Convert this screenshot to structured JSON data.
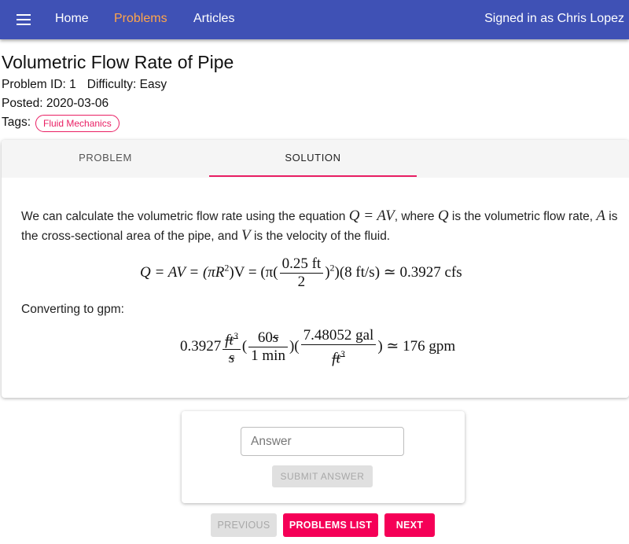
{
  "nav": {
    "items": [
      "Home",
      "Problems",
      "Articles"
    ],
    "active_color": "#ffa54a",
    "bar_color": "#3f51b5",
    "signed_in": "Signed in as Chris Lopez"
  },
  "problem": {
    "title": "Volumetric Flow Rate of Pipe",
    "problem_id": "Problem ID: 1",
    "difficulty": "Difficulty: Easy",
    "posted": "Posted: 2020-03-06",
    "tags_label": "Tags:",
    "tags": [
      "Fluid Mechanics"
    ],
    "tag_color": "#e91e63"
  },
  "tabs": [
    "PROBLEM",
    "SOLUTION"
  ],
  "active_tab": "SOLUTION",
  "solution": {
    "p1_a": "We can calculate the volumetric flow rate using the equation ",
    "p1_eq": "Q = AV",
    "p1_b": ", where ",
    "p1_q": "Q",
    "p1_c": " is the volumetric flow rate, ",
    "p1_a_var": "A",
    "p1_d": " is the cross-sectional area of the pipe, and ",
    "p1_v": "V",
    "p1_e": " is the velocity of the fluid.",
    "eq1_lhs": "Q = AV = (πR",
    "eq1_sq": "2",
    "eq1_mid": ")V = (π(",
    "eq1_num": "0.25 ft",
    "eq1_den": "2",
    "eq1_after": ")",
    "eq1_sq2": "2",
    "eq1_rhs": ")(8 ft/s) ≃ 0.3927 cfs",
    "converting": "Converting to gpm:",
    "eq2_coef": "0.3927",
    "eq2_f1_num": "ft",
    "eq2_f1_num_exp": "3",
    "eq2_f1_den": "s",
    "eq2_f2_num_val": "60",
    "eq2_f2_num_unit": "s",
    "eq2_f2_den": "1 min",
    "eq2_f3_num": "7.48052 gal",
    "eq2_f3_den": "ft",
    "eq2_f3_den_exp": "3",
    "eq2_rhs": ") ≃ 176 gpm"
  },
  "answer": {
    "placeholder": "Answer",
    "submit": "SUBMIT ANSWER"
  },
  "buttons": {
    "previous": "PREVIOUS",
    "list": "PROBLEMS LIST",
    "next": "NEXT",
    "accent": "#f50057"
  }
}
